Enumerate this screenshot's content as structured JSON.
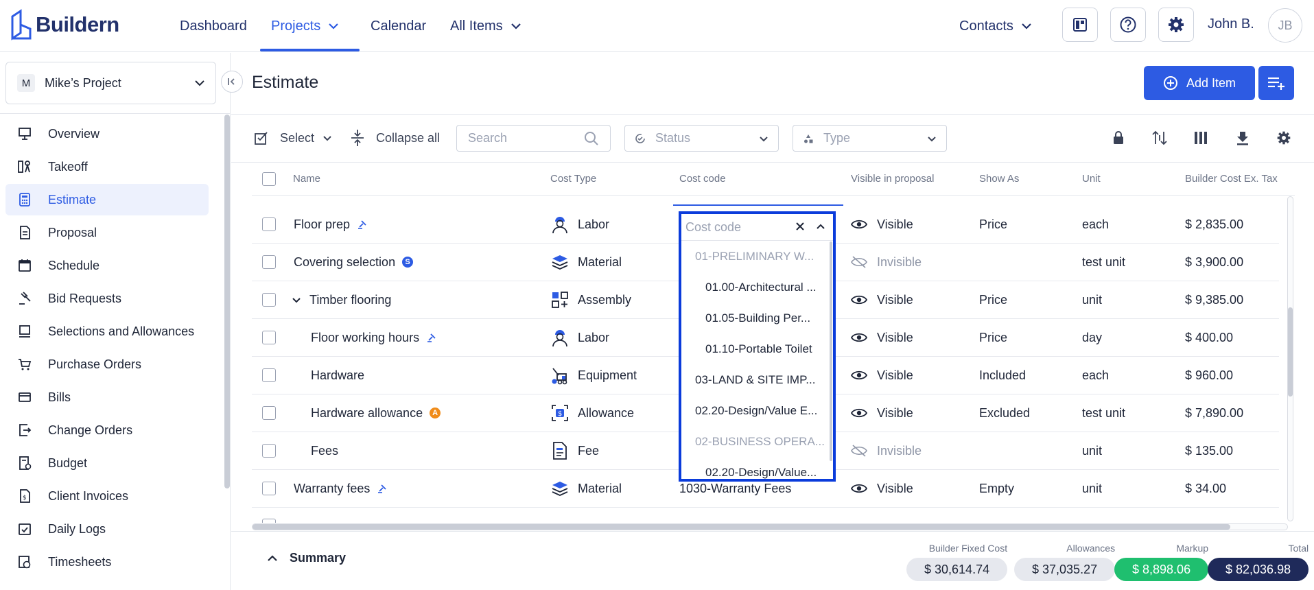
{
  "app": {
    "brand": "Buildern"
  },
  "topnav": {
    "items": [
      {
        "label": "Dashboard"
      },
      {
        "label": "Projects"
      },
      {
        "label": "Calendar"
      },
      {
        "label": "All Items"
      }
    ],
    "contacts": "Contacts",
    "user": {
      "name": "John B.",
      "initials": "JB"
    }
  },
  "sidebar": {
    "project": {
      "badge": "M",
      "name": "Mike’s Project"
    },
    "items": [
      {
        "label": "Overview",
        "icon": "presentation-icon"
      },
      {
        "label": "Takeoff",
        "icon": "takeoff-icon"
      },
      {
        "label": "Estimate",
        "icon": "calculator-icon"
      },
      {
        "label": "Proposal",
        "icon": "proposal-icon"
      },
      {
        "label": "Schedule",
        "icon": "calendar-icon"
      },
      {
        "label": "Bid Requests",
        "icon": "gavel-icon"
      },
      {
        "label": "Selections and Allowances",
        "icon": "selection-icon"
      },
      {
        "label": "Purchase Orders",
        "icon": "cart-icon"
      },
      {
        "label": "Bills",
        "icon": "bill-icon"
      },
      {
        "label": "Change Orders",
        "icon": "change-order-icon"
      },
      {
        "label": "Budget",
        "icon": "budget-icon"
      },
      {
        "label": "Client Invoices",
        "icon": "invoice-icon"
      },
      {
        "label": "Daily Logs",
        "icon": "daily-log-icon"
      },
      {
        "label": "Timesheets",
        "icon": "timesheet-icon"
      }
    ]
  },
  "page": {
    "title": "Estimate",
    "add_item": "Add Item"
  },
  "toolbar": {
    "select": "Select",
    "collapse_all": "Collapse all",
    "search_placeholder": "Search",
    "status_placeholder": "Status",
    "type_placeholder": "Type"
  },
  "table": {
    "columns": {
      "name": "Name",
      "cost_type": "Cost Type",
      "cost_code": "Cost code",
      "visible": "Visible in proposal",
      "show_as": "Show As",
      "unit": "Unit",
      "builder_cost": "Builder Cost Ex. Tax"
    },
    "rows": [
      {
        "name": "Floor prep",
        "cost_type": "Labor",
        "cost_code": "",
        "visible": "Visible",
        "show_as": "Price",
        "unit": "each",
        "cost": "$ 2,835.00"
      },
      {
        "name": "Covering selection",
        "badge": "S",
        "cost_type": "Material",
        "cost_code": "",
        "visible": "Invisible",
        "show_as": "",
        "unit": "test unit",
        "cost": "$ 3,900.00"
      },
      {
        "name": "Timber flooring",
        "cost_type": "Assembly",
        "cost_code": "",
        "visible": "Visible",
        "show_as": "Price",
        "unit": "unit",
        "cost": "$ 9,385.00"
      },
      {
        "name": "Floor working hours",
        "cost_type": "Labor",
        "cost_code": "",
        "visible": "Visible",
        "show_as": "Price",
        "unit": "day",
        "cost": "$ 400.00"
      },
      {
        "name": "Hardware",
        "cost_type": "Equipment",
        "cost_code": "",
        "visible": "Visible",
        "show_as": "Included",
        "unit": "each",
        "cost": "$ 960.00"
      },
      {
        "name": "Hardware allowance",
        "badge": "A",
        "cost_type": "Allowance",
        "cost_code": "",
        "visible": "Visible",
        "show_as": "Excluded",
        "unit": "test unit",
        "cost": "$ 7,890.00"
      },
      {
        "name": "Fees",
        "cost_type": "Fee",
        "cost_code": "",
        "visible": "Invisible",
        "show_as": "",
        "unit": "unit",
        "cost": "$ 135.00"
      },
      {
        "name": "Warranty fees",
        "cost_type": "Material",
        "cost_code": "1030-Warranty Fees",
        "visible": "Visible",
        "show_as": "Empty",
        "unit": "unit",
        "cost": "$ 34.00"
      }
    ]
  },
  "cost_code_dropdown": {
    "placeholder": "Cost code",
    "options": [
      {
        "label": "01-PRELIMINARY W...",
        "group": true
      },
      {
        "label": "01.00-Architectural ...",
        "group": false
      },
      {
        "label": "01.05-Building Per...",
        "group": false
      },
      {
        "label": "01.10-Portable Toilet",
        "group": false
      },
      {
        "label": "03-LAND & SITE IMP...",
        "group": false
      },
      {
        "label": "02.20-Design/Value E...",
        "group": false
      },
      {
        "label": "02-BUSINESS OPERA...",
        "group": true
      },
      {
        "label": "02.20-Design/Value...",
        "group": false
      }
    ]
  },
  "summary": {
    "label": "Summary",
    "builder_fixed_cost": {
      "label": "Builder Fixed Cost",
      "value": "$ 30,614.74"
    },
    "allowances": {
      "label": "Allowances",
      "value": "$ 37,035.27"
    },
    "markup": {
      "label": "Markup",
      "value": "$ 8,898.06"
    },
    "total": {
      "label": "Total",
      "value": "$ 82,036.98"
    }
  },
  "colors": {
    "accent": "#2d5be3",
    "markup": "#1fbf6f",
    "total": "#1f2a5a"
  }
}
